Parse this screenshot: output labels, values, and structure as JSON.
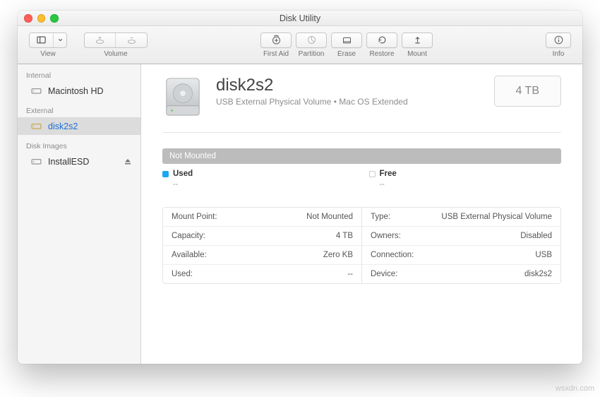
{
  "title": "Disk Utility",
  "traffic": [
    "close",
    "minimize",
    "zoom"
  ],
  "toolbar": {
    "view_label": "View",
    "volume_label": "Volume",
    "actions": {
      "first_aid": "First Aid",
      "partition": "Partition",
      "erase": "Erase",
      "restore": "Restore",
      "mount": "Mount"
    },
    "info_label": "Info"
  },
  "sidebar": {
    "sections": [
      {
        "label": "Internal",
        "items": [
          {
            "name": "Macintosh HD"
          }
        ]
      },
      {
        "label": "External",
        "items": [
          {
            "name": "disk2s2",
            "selected": true
          }
        ]
      },
      {
        "label": "Disk Images",
        "items": [
          {
            "name": "InstallESD",
            "eject": true
          }
        ]
      }
    ]
  },
  "main": {
    "name": "disk2s2",
    "subtitle": "USB External Physical Volume • Mac OS Extended",
    "capacity_badge": "4 TB",
    "status": "Not Mounted",
    "usage": {
      "used_label": "Used",
      "used_value": "--",
      "free_label": "Free",
      "free_value": "--"
    },
    "details_left": [
      {
        "k": "Mount Point:",
        "v": "Not Mounted"
      },
      {
        "k": "Capacity:",
        "v": "4 TB"
      },
      {
        "k": "Available:",
        "v": "Zero KB"
      },
      {
        "k": "Used:",
        "v": "--"
      }
    ],
    "details_right": [
      {
        "k": "Type:",
        "v": "USB External Physical Volume"
      },
      {
        "k": "Owners:",
        "v": "Disabled"
      },
      {
        "k": "Connection:",
        "v": "USB"
      },
      {
        "k": "Device:",
        "v": "disk2s2"
      }
    ]
  },
  "watermark": "wsxdn.com"
}
